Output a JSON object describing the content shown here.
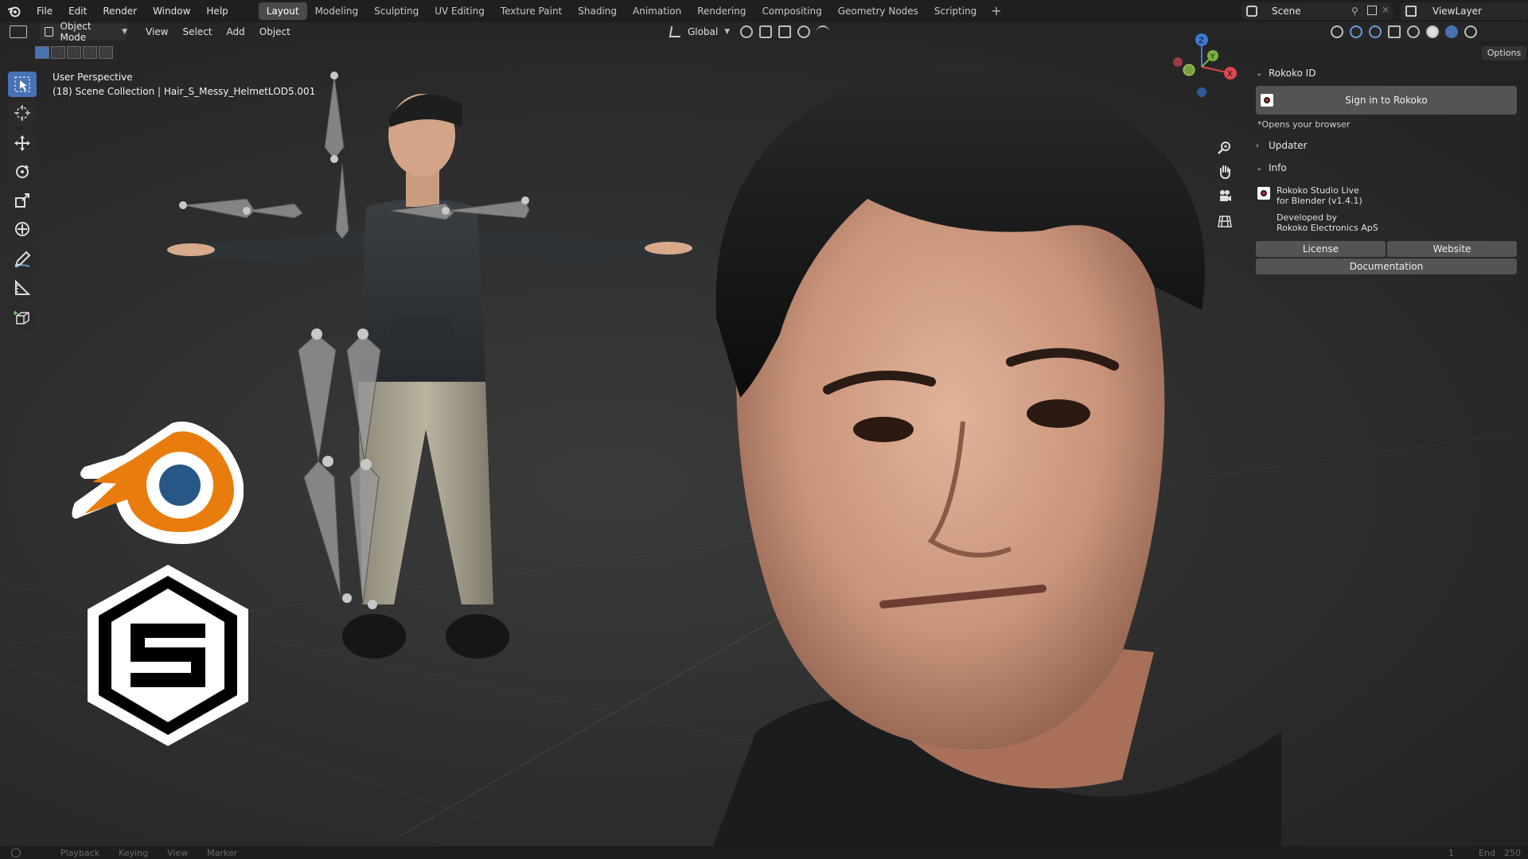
{
  "topbar": {
    "menu": [
      "File",
      "Edit",
      "Render",
      "Window",
      "Help"
    ],
    "workspaces": [
      "Layout",
      "Modeling",
      "Sculpting",
      "UV Editing",
      "Texture Paint",
      "Shading",
      "Animation",
      "Rendering",
      "Compositing",
      "Geometry Nodes",
      "Scripting"
    ],
    "active_workspace": "Layout",
    "scene": "Scene",
    "view_layer": "ViewLayer"
  },
  "header": {
    "mode": "Object Mode",
    "menus": [
      "View",
      "Select",
      "Add",
      "Object"
    ],
    "orientation": "Global",
    "options": "Options"
  },
  "viewport": {
    "perspective": "User Perspective",
    "collection_info": "(18) Scene Collection | Hair_S_Messy_HelmetLOD5.001"
  },
  "gizmo": {
    "z": "Z",
    "y": "Y",
    "x": "X"
  },
  "npanel": {
    "rokoko_id_title": "Rokoko ID",
    "sign_in": "Sign in to Rokoko",
    "opens_browser": "*Opens your browser",
    "updater_title": "Updater",
    "info_title": "Info",
    "info_line1": "Rokoko Studio Live",
    "info_line2": "for Blender (v1.4.1)",
    "info_line3": "Developed by",
    "info_line4": "Rokoko Electronics ApS",
    "license": "License",
    "website": "Website",
    "documentation": "Documentation"
  },
  "bottombar": {
    "items": [
      "Playback",
      "Keying",
      "View",
      "Marker"
    ],
    "frame": "1",
    "end_label": "End",
    "end_value": "250"
  },
  "colors": {
    "accent": "#4772b3",
    "blender_orange": "#e87d0d",
    "blender_blue": "#265787"
  }
}
